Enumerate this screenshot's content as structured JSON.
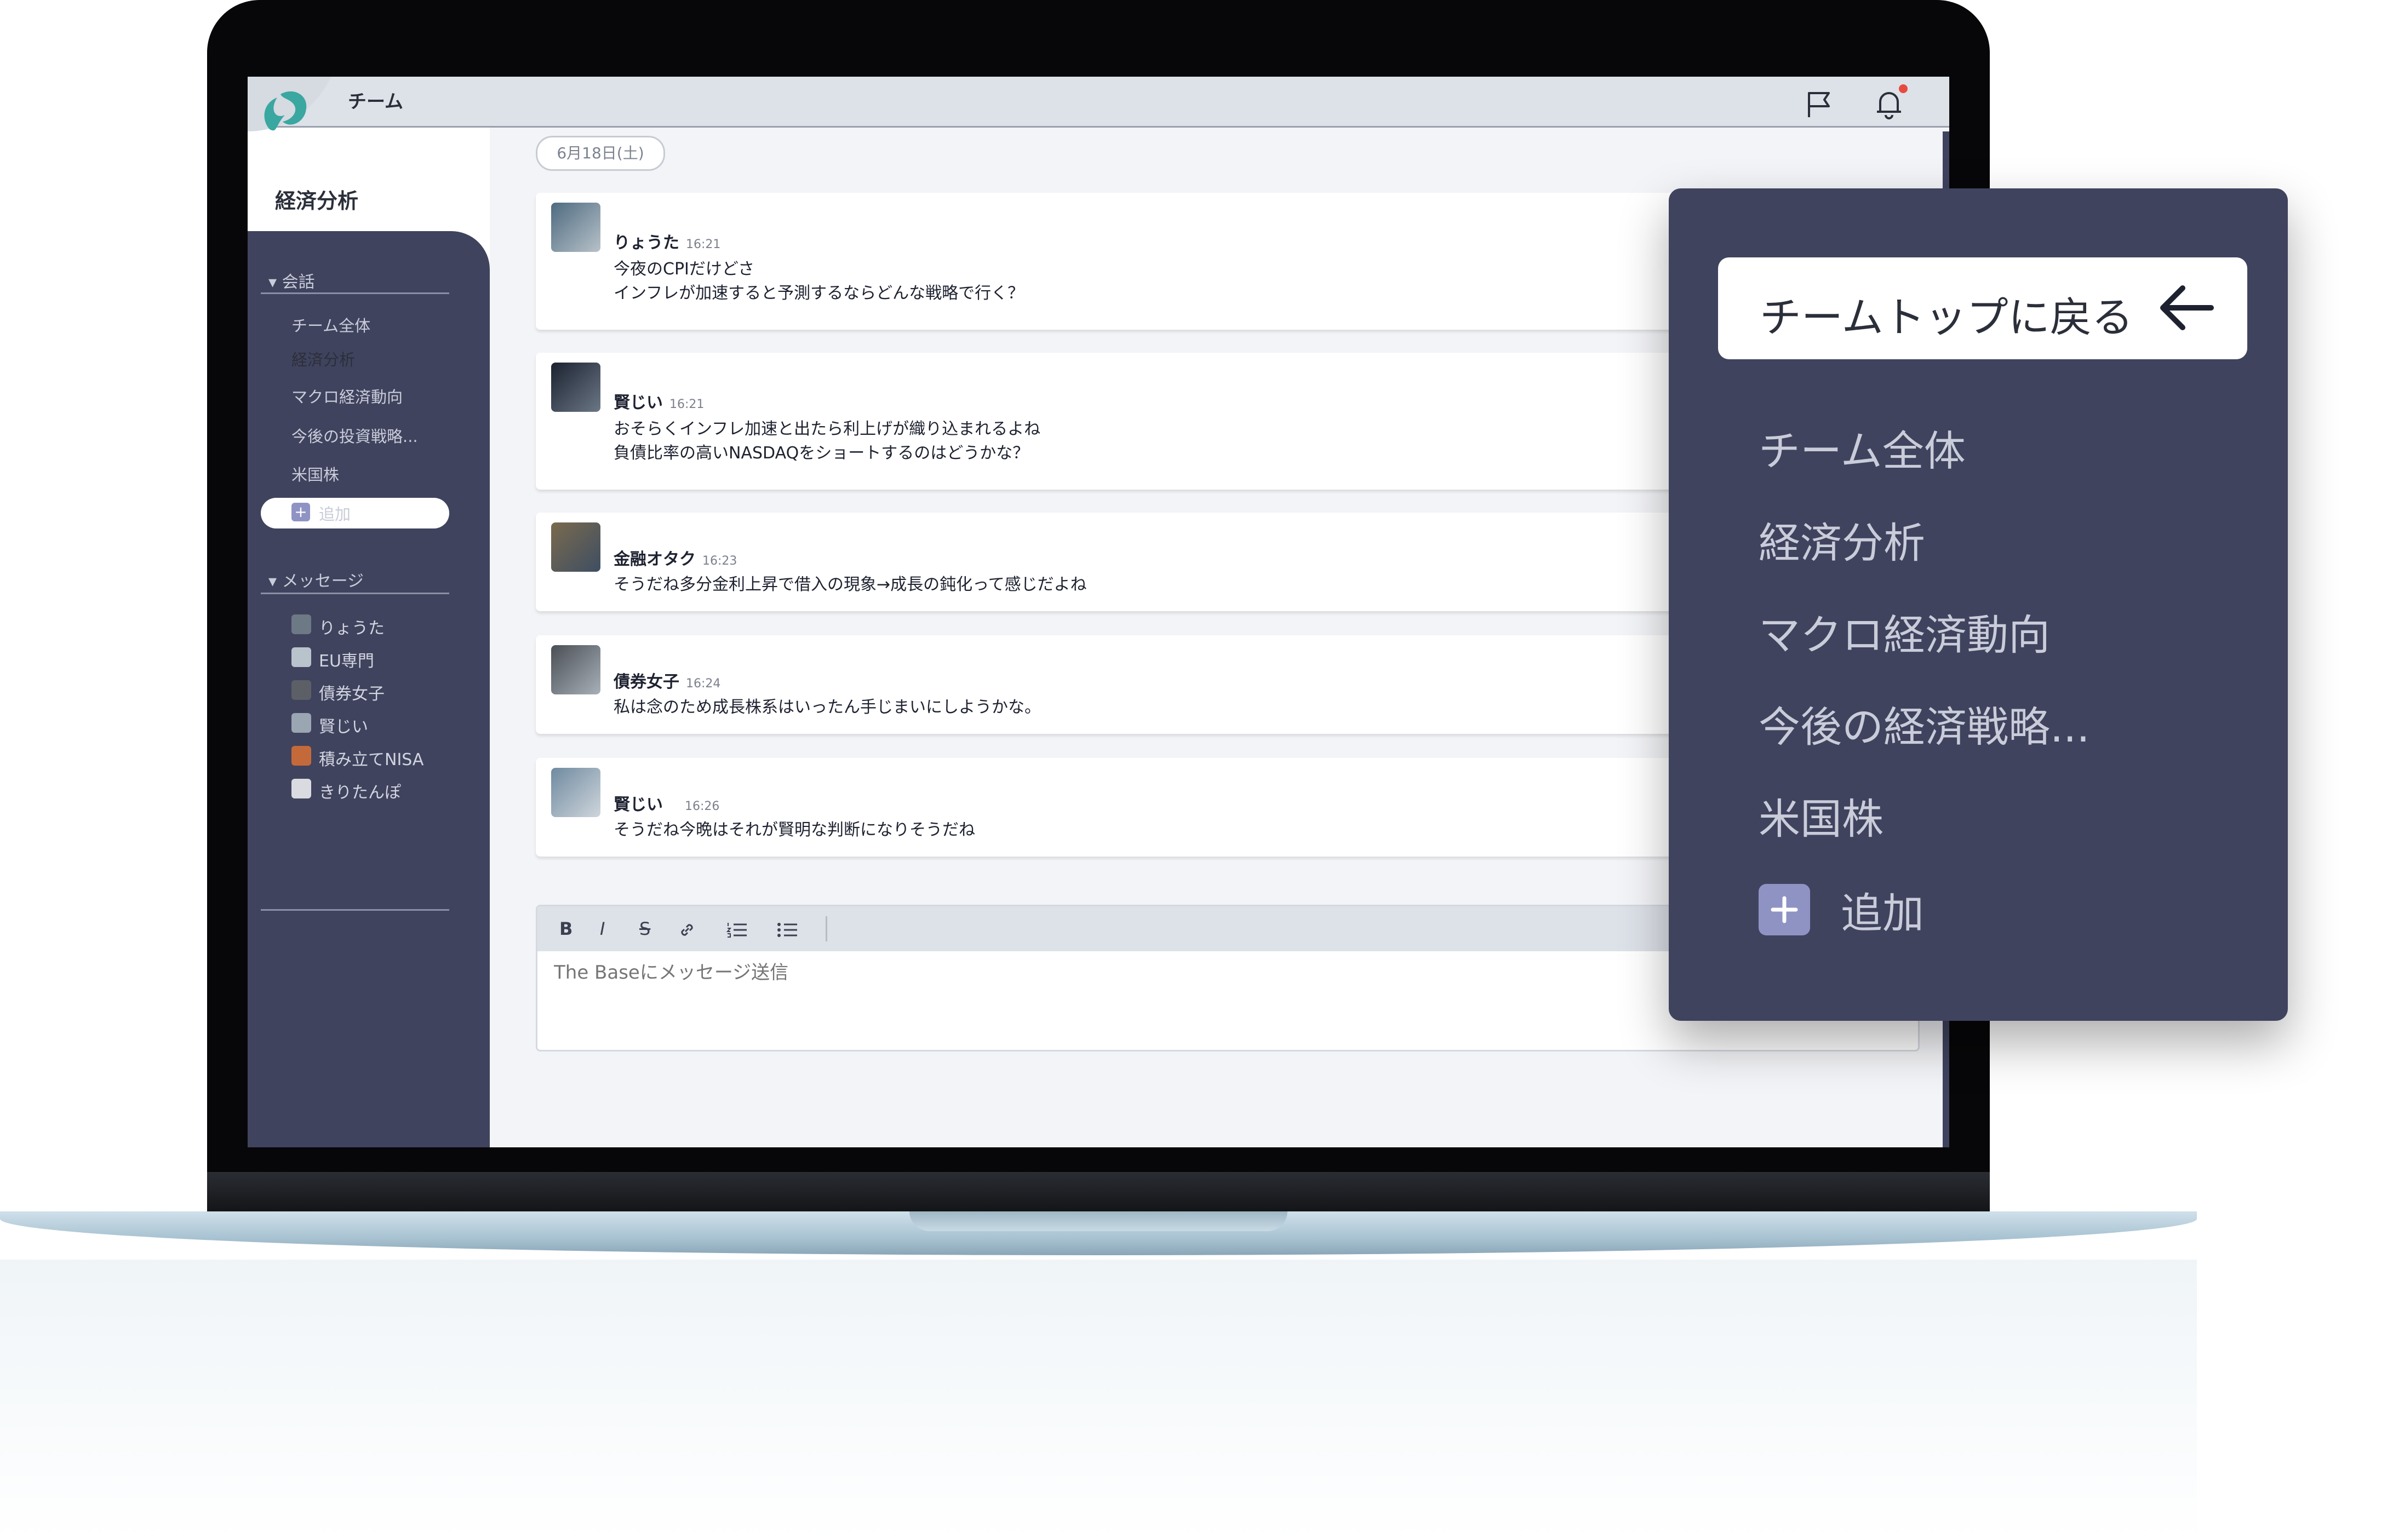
{
  "header": {
    "title": "チーム"
  },
  "channel": {
    "title": "経済分析"
  },
  "sidebar": {
    "conversations_heading": "会話",
    "channels": [
      {
        "label": "チーム全体"
      },
      {
        "label": "経済分析",
        "active": true
      },
      {
        "label": "マクロ経済動向"
      },
      {
        "label": "今後の投資戦略..."
      },
      {
        "label": "米国株"
      }
    ],
    "add_label": "追加",
    "messages_heading": "メッセージ",
    "dms": [
      {
        "label": "りょうた"
      },
      {
        "label": "EU専門"
      },
      {
        "label": "債券女子"
      },
      {
        "label": "賢じい"
      },
      {
        "label": "積み立てNISA"
      },
      {
        "label": "きりたんぽ"
      }
    ]
  },
  "feed": {
    "date": "6月18日(土)",
    "messages": [
      {
        "user": "りょうた",
        "time": "16:21",
        "text": "今夜のCPIだけどさ\nインフレが加速すると予測するならどんな戦略で行く？"
      },
      {
        "user": "賢じい",
        "time": "16:21",
        "text": "おそらくインフレ加速と出たら利上げが織り込まれるよね\n負債比率の高いNASDAQをショートするのはどうかな？"
      },
      {
        "user": "金融オタク",
        "time": "16:23",
        "text": "そうだね多分金利上昇で借入の現象→成長の鈍化って感じだよね"
      },
      {
        "user": "債券女子",
        "time": "16:24",
        "text": "私は念のため成長株系はいったん手じまいにしようかな。"
      },
      {
        "user": "賢じい",
        "time": "16:26",
        "text": "そうだね今晩はそれが賢明な判断になりそうだね"
      }
    ]
  },
  "composer": {
    "placeholder": "The Baseにメッセージ送信",
    "bold": "B",
    "italic": "I",
    "strike": "S"
  },
  "panel": {
    "back_label": "チームトップに戻る",
    "items": [
      {
        "label": "チーム全体"
      },
      {
        "label": "経済分析"
      },
      {
        "label": "マクロ経済動向"
      },
      {
        "label": "今後の経済戦略..."
      },
      {
        "label": "米国株"
      }
    ],
    "add_label": "追加"
  },
  "colors": {
    "sidebar": "#40435e",
    "topbar": "#dde1e8",
    "logo_teal": "#3aa7a0",
    "notification": "#e84a3f"
  }
}
